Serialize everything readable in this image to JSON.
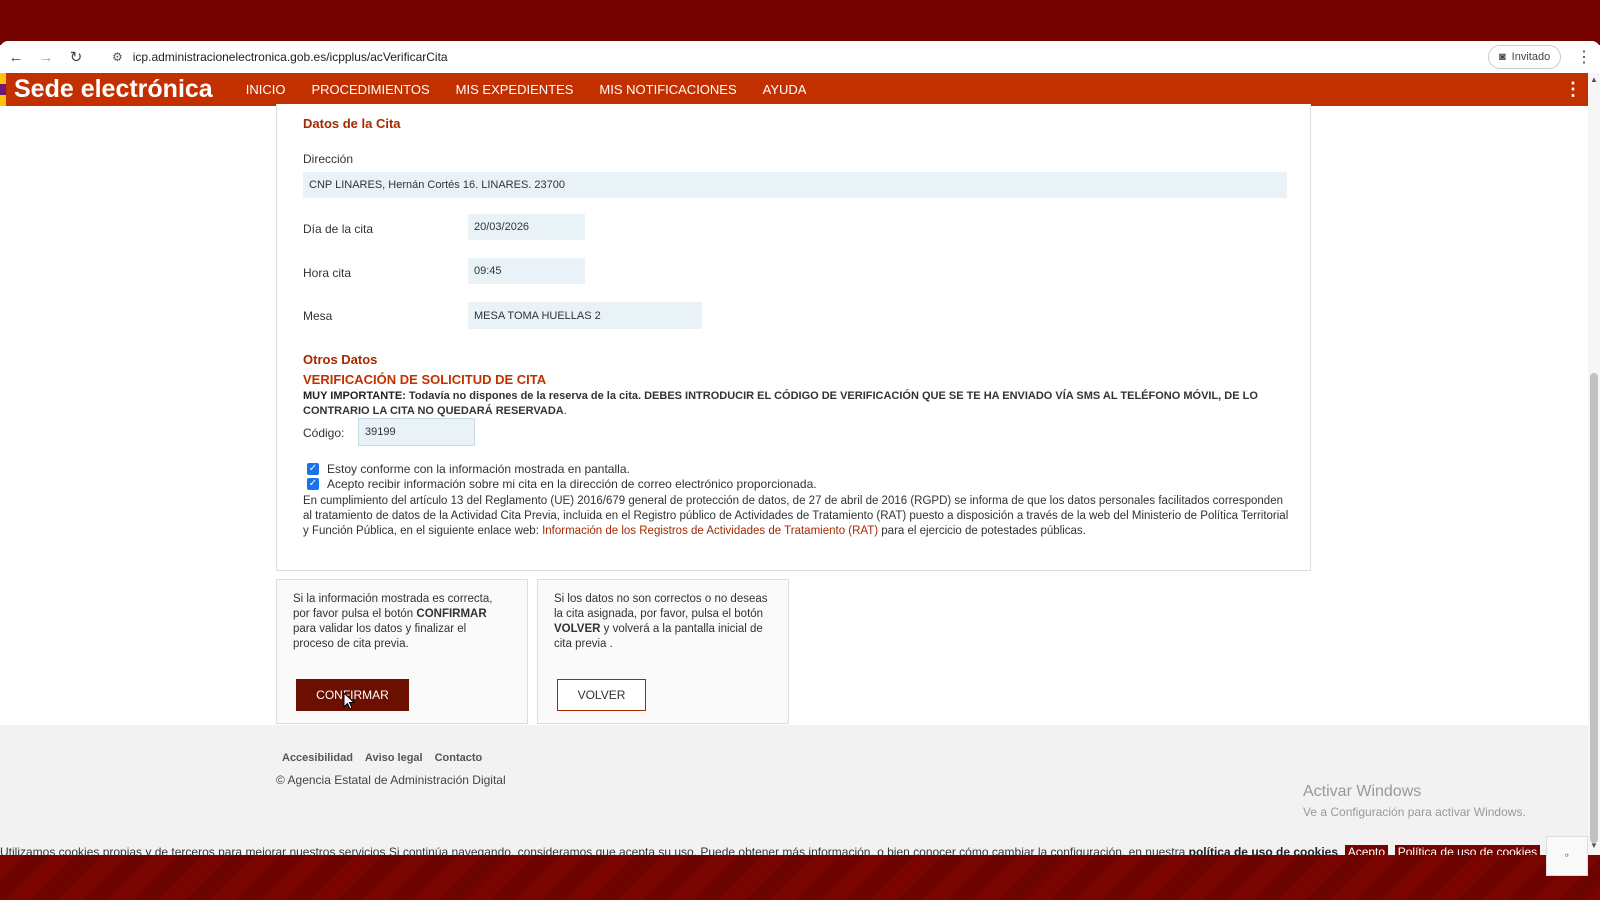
{
  "browser": {
    "url": "icp.administracionelectronica.gob.es/icpplus/acVerificarCita",
    "profile_label": "Invitado"
  },
  "header": {
    "title": "Sede electrónica",
    "nav": [
      "INICIO",
      "PROCEDIMIENTOS",
      "MIS EXPEDIENTES",
      "MIS NOTIFICACIONES",
      "AYUDA"
    ]
  },
  "cita": {
    "section_title": "Datos de la Cita",
    "direccion_label": "Dirección",
    "direccion_value": "CNP LINARES, Hernán Cortés 16. LINARES. 23700",
    "dia_label": "Día de la cita",
    "dia_value": "20/03/2026",
    "hora_label": "Hora cita",
    "hora_value": "09:45",
    "mesa_label": "Mesa",
    "mesa_value": "MESA TOMA HUELLAS 2"
  },
  "otros": {
    "section_title": "Otros Datos",
    "verif_title": "VERIFICACIÓN DE SOLICITUD DE CITA",
    "important_lead": "MUY IMPORTANTE:",
    "important_text": " Todavía no dispones de la reserva de la cita. DEBES INTRODUCIR EL CÓDIGO DE VERIFICACIÓN QUE SE TE HA ENVIADO VÍA SMS AL TELÉFONO MÓVIL, DE LO CONTRARIO LA CITA NO QUEDARÁ RESERVADA",
    "important_end": ".",
    "codigo_label": "Código:",
    "codigo_value": "39199",
    "check1": "Estoy conforme con la información mostrada en pantalla.",
    "check2": "Acepto recibir información sobre mi cita en la dirección de correo electrónico proporcionada.",
    "legal_text": "En cumplimiento del artículo 13 del Reglamento (UE) 2016/679 general de protección de datos, de 27 de abril de 2016 (RGPD) se informa de que los datos personales facilitados corresponden al tratamiento de datos de la Actividad Cita Previa, incluida en el Registro público de Actividades de Tratamiento (RAT) puesto a disposición a través de la web del Ministerio de Política Territorial y Función Pública, en el siguiente enlace web: ",
    "legal_link": "Información de los Registros de Actividades de Tratamiento (RAT)",
    "legal_tail": " para el ejercicio de potestades públicas."
  },
  "actions": {
    "confirm_text_1": "Si la información mostrada es correcta, por favor pulsa el botón ",
    "confirm_bold": "CONFIRMAR",
    "confirm_text_2": " para validar los datos y finalizar el proceso de cita previa.",
    "confirm_button": "CONFIRMAR",
    "back_text_1": "Si los datos no son correctos o no deseas la cita asignada, por favor, pulsa el botón ",
    "back_bold": "VOLVER",
    "back_text_2": " y volverá a la pantalla inicial de cita previa .",
    "back_button": "VOLVER"
  },
  "footer": {
    "links": [
      "Accesibilidad",
      "Aviso legal",
      "Contacto"
    ],
    "copyright": "© Agencia Estatal de Administración Digital",
    "activate_title": "Activar Windows",
    "activate_sub": "Ve a Configuración para activar Windows."
  },
  "cookies": {
    "text": "Utilizamos cookies propias y de terceros para mejorar nuestros servicios Si continúa navegando, consideramos que acepta su uso. Puede obtener más información, o bien conocer cómo cambiar la configuración, en nuestra ",
    "policy_link": "política de uso de cookies",
    "accept": "Acepto",
    "policy_button": "Política de uso de cookies"
  },
  "colors": {
    "brand": "#c23000",
    "dark_band": "#750400",
    "confirm_button": "#6b0f00"
  }
}
